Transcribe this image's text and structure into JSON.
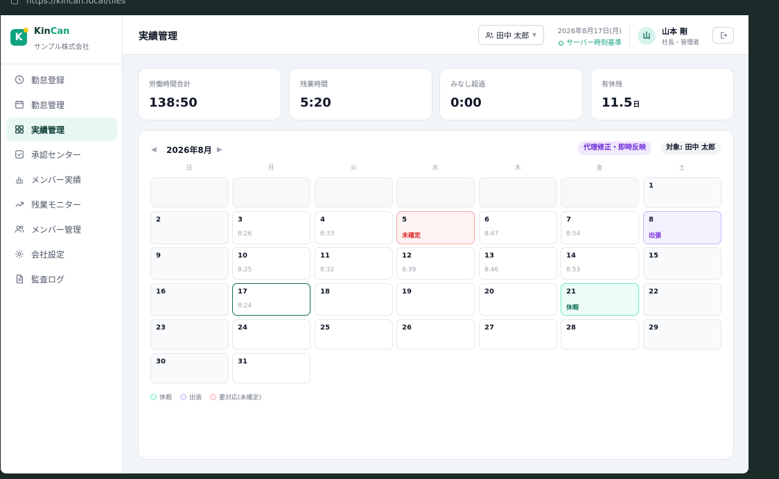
{
  "browser": {
    "url": "https://kincan.local/tiles"
  },
  "brand": {
    "name_part1": "Kin",
    "name_part2": "Can",
    "logo_letter": "K",
    "company": "サンプル株式会社"
  },
  "sidebar": {
    "items": [
      {
        "label": "勤怠登録",
        "icon": "clock-icon"
      },
      {
        "label": "勤怠管理",
        "icon": "calendar-icon"
      },
      {
        "label": "実績管理",
        "icon": "grid-icon",
        "active": true
      },
      {
        "label": "承認センター",
        "icon": "check-square-icon"
      },
      {
        "label": "メンバー実績",
        "icon": "bar-chart-icon"
      },
      {
        "label": "残業モニター",
        "icon": "trend-icon"
      },
      {
        "label": "メンバー管理",
        "icon": "users-icon"
      },
      {
        "label": "会社設定",
        "icon": "gear-icon"
      },
      {
        "label": "監査ログ",
        "icon": "document-icon"
      }
    ]
  },
  "header": {
    "title": "実績管理",
    "user_select": "田中 太郎",
    "date": "2026年8月17日(月)",
    "server_basis": "サーバー時刻基準",
    "avatar_letter": "山",
    "user_name": "山本 剛",
    "user_role": "社長・管理者"
  },
  "stats": [
    {
      "label": "労働時間合計",
      "value": "138:50",
      "unit": ""
    },
    {
      "label": "残業時間",
      "value": "5:20",
      "unit": ""
    },
    {
      "label": "みなし超過",
      "value": "0:00",
      "unit": ""
    },
    {
      "label": "有休残",
      "value": "11.5",
      "unit": "日"
    }
  ],
  "calendar": {
    "month_label": "2026年8月",
    "prev": "◀",
    "next": "▶",
    "badge_proxy": "代理修正・即時反映",
    "badge_target": "対象: 田中 太郎",
    "weekdays": [
      "日",
      "月",
      "火",
      "水",
      "木",
      "金",
      "土"
    ],
    "leading_empty": 6,
    "today": 17,
    "days": [
      {
        "day": "1",
        "sub": "",
        "status": ""
      },
      {
        "day": "2",
        "sub": "",
        "status": ""
      },
      {
        "day": "3",
        "sub": "8:26",
        "status": ""
      },
      {
        "day": "4",
        "sub": "8:33",
        "status": ""
      },
      {
        "day": "5",
        "sub": "未確定",
        "status": "unconfirmed"
      },
      {
        "day": "6",
        "sub": "8:47",
        "status": ""
      },
      {
        "day": "7",
        "sub": "8:54",
        "status": ""
      },
      {
        "day": "8",
        "sub": "出張",
        "status": "trip"
      },
      {
        "day": "9",
        "sub": "",
        "status": ""
      },
      {
        "day": "10",
        "sub": "8:25",
        "status": ""
      },
      {
        "day": "11",
        "sub": "8:32",
        "status": ""
      },
      {
        "day": "12",
        "sub": "8:39",
        "status": ""
      },
      {
        "day": "13",
        "sub": "8:46",
        "status": ""
      },
      {
        "day": "14",
        "sub": "8:53",
        "status": ""
      },
      {
        "day": "15",
        "sub": "",
        "status": ""
      },
      {
        "day": "16",
        "sub": "",
        "status": ""
      },
      {
        "day": "17",
        "sub": "8:24",
        "status": ""
      },
      {
        "day": "18",
        "sub": "",
        "status": ""
      },
      {
        "day": "19",
        "sub": "",
        "status": ""
      },
      {
        "day": "20",
        "sub": "",
        "status": ""
      },
      {
        "day": "21",
        "sub": "休暇",
        "status": "leave"
      },
      {
        "day": "22",
        "sub": "",
        "status": ""
      },
      {
        "day": "23",
        "sub": "",
        "status": ""
      },
      {
        "day": "24",
        "sub": "",
        "status": ""
      },
      {
        "day": "25",
        "sub": "",
        "status": ""
      },
      {
        "day": "26",
        "sub": "",
        "status": ""
      },
      {
        "day": "27",
        "sub": "",
        "status": ""
      },
      {
        "day": "28",
        "sub": "",
        "status": ""
      },
      {
        "day": "29",
        "sub": "",
        "status": ""
      },
      {
        "day": "30",
        "sub": "",
        "status": ""
      },
      {
        "day": "31",
        "sub": "",
        "status": ""
      }
    ],
    "legend": [
      {
        "label": "休暇"
      },
      {
        "label": "出張"
      },
      {
        "label": "要対応(未確定)"
      }
    ]
  },
  "colors": {
    "accent": "#10a37f",
    "brand_dark": "#0f3d36",
    "unconfirmed": "#dc2626",
    "trip": "#6d28d9"
  }
}
